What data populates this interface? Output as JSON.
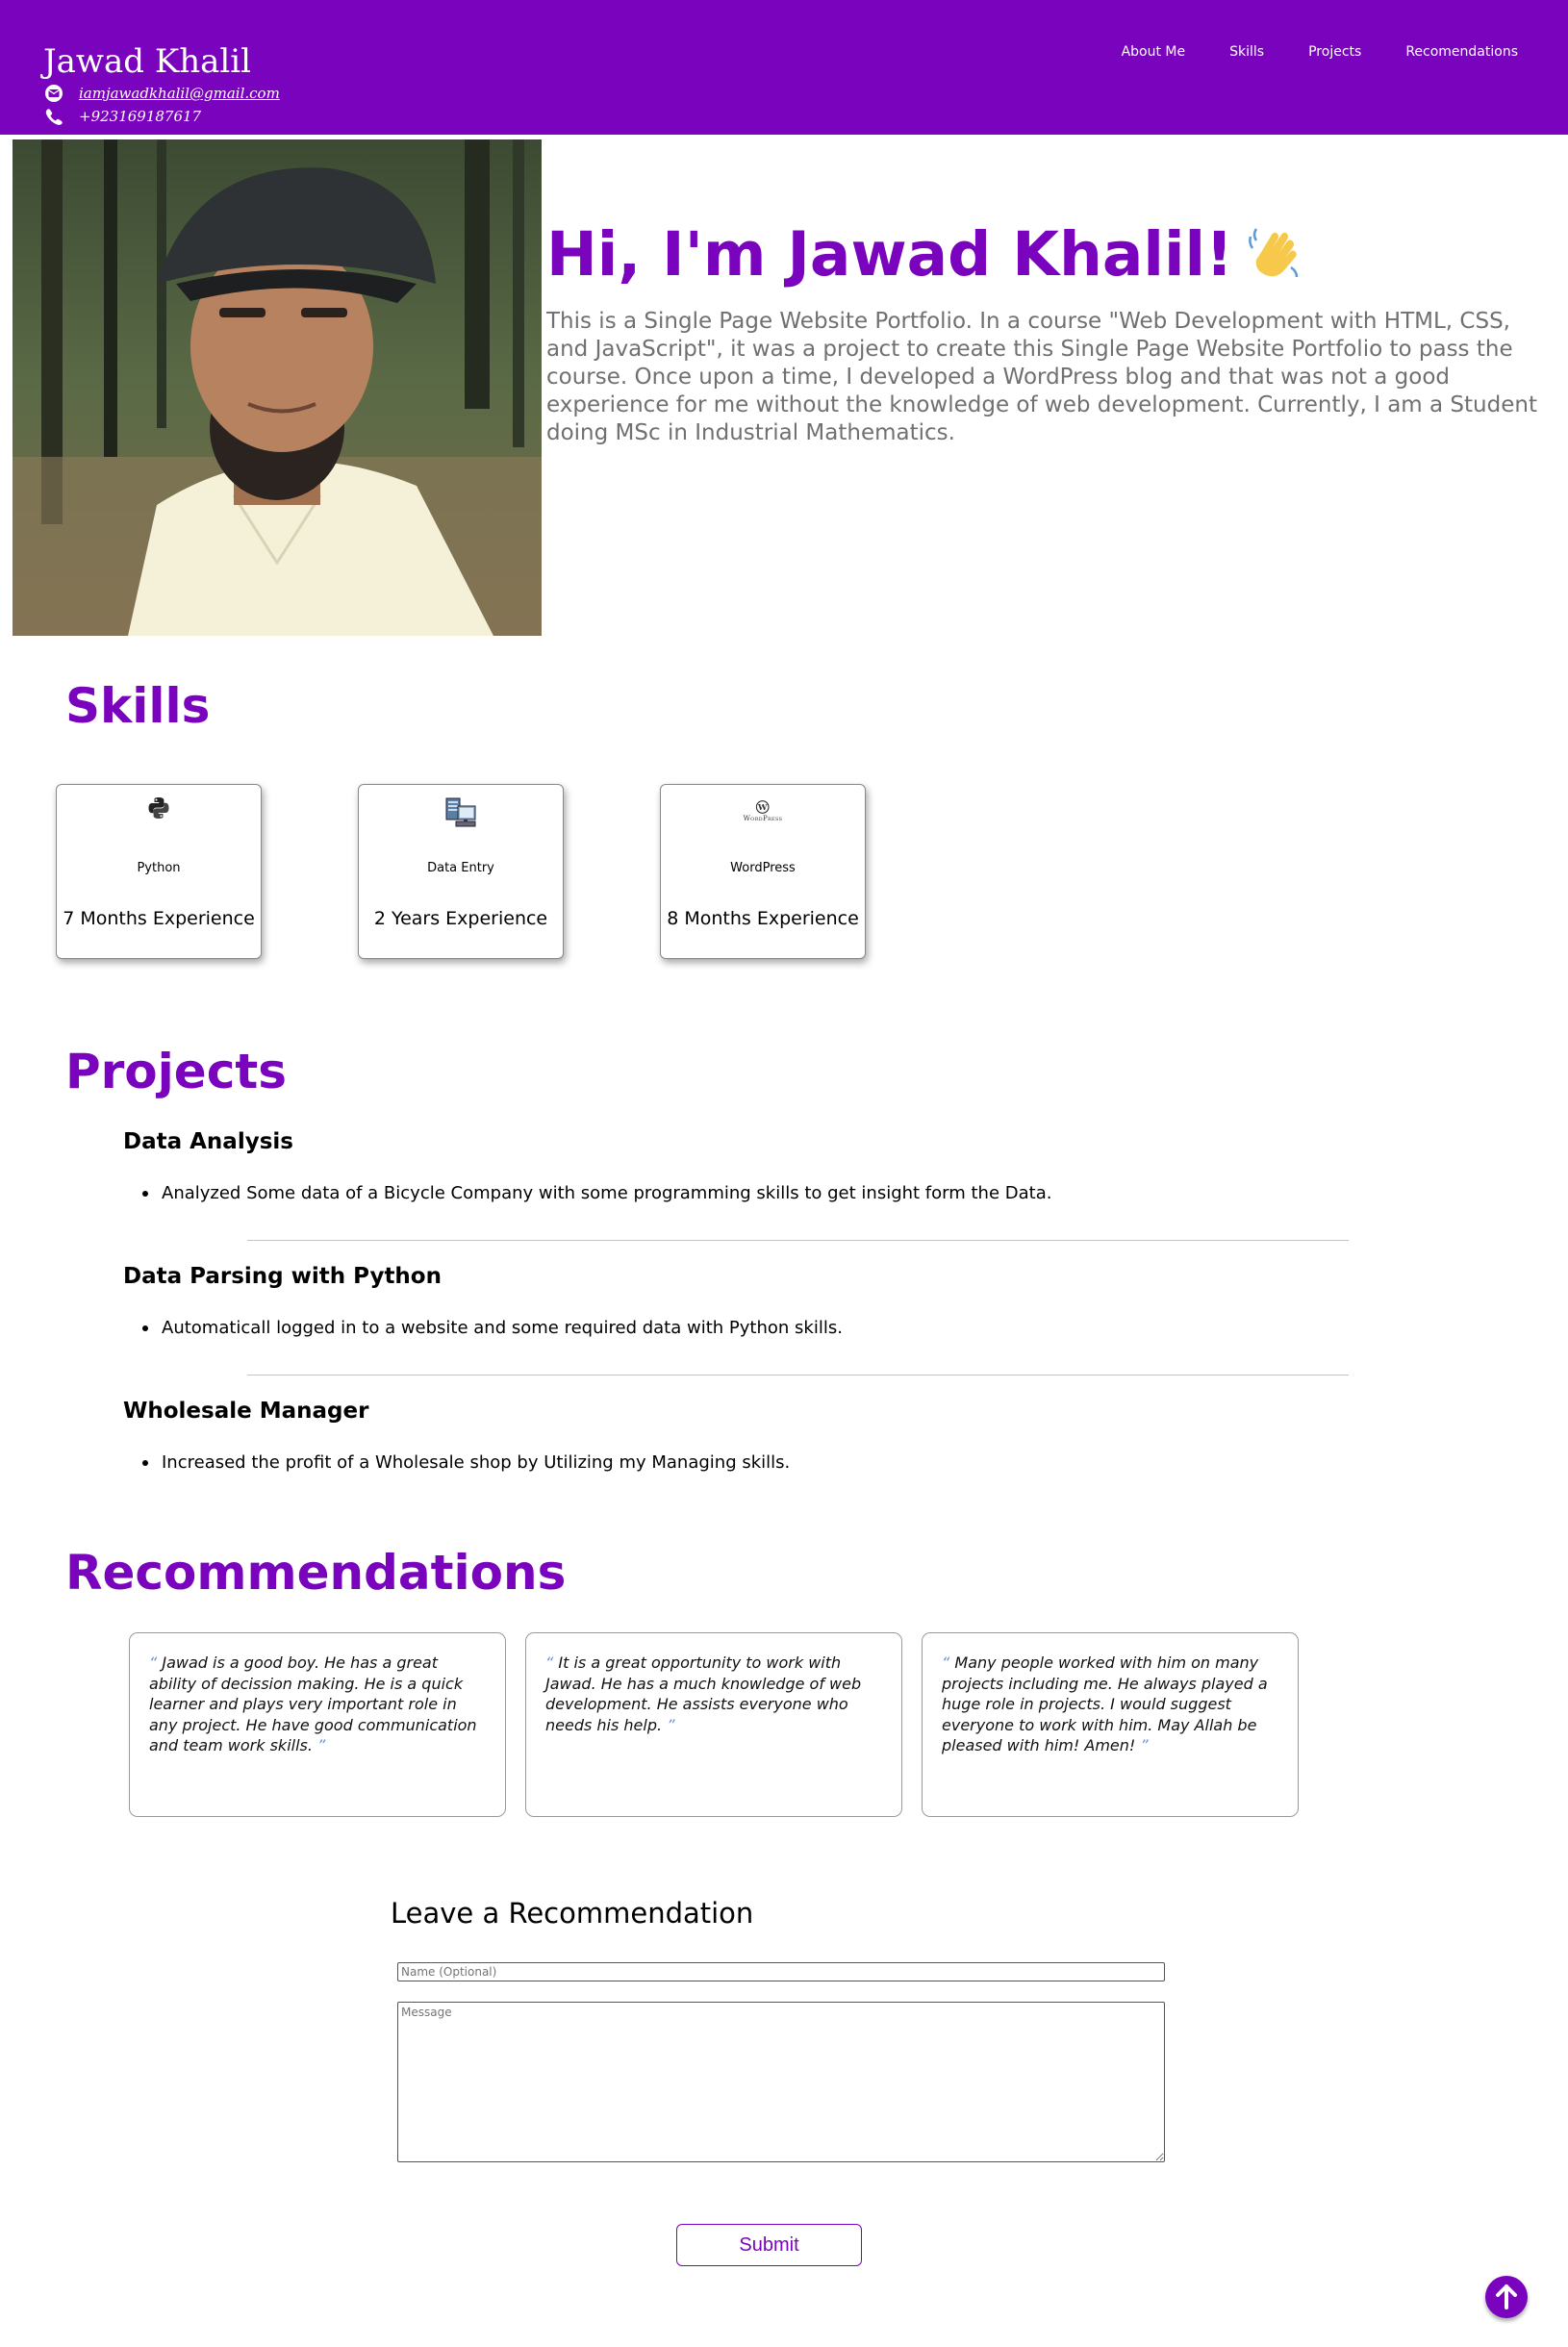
{
  "colors": {
    "accent": "#7a03bd",
    "white": "#ffffff",
    "gray_text": "#707070"
  },
  "header": {
    "name": "Jawad Khalil",
    "email": "iamjawadkhalil@gmail.com",
    "phone": "+923169187617",
    "email_icon": "envelope-icon",
    "phone_icon": "phone-icon",
    "nav": [
      "About Me",
      "Skills",
      "Projects",
      "Recomendations"
    ]
  },
  "profile": {
    "photo_alt": "profile-photo",
    "greeting": "Hi, I'm Jawad Khalil!",
    "wave_icon": "waving-hand-icon",
    "bio": "This is a Single Page Website Portfolio. In a course \"Web Development with HTML, CSS, and JavaScript\", it was a project to create this Single Page Website Portfolio to pass the course. Once upon a time, I developed a WordPress blog and that was not a good experience for me without the knowledge of web development. Currently, I am a Student doing MSc in Industrial Mathematics."
  },
  "skills": {
    "title": "Skills",
    "items": [
      {
        "icon": "python-icon",
        "name": "Python",
        "experience": "7 Months Experience"
      },
      {
        "icon": "data-entry-icon",
        "name": "Data Entry",
        "experience": "2 Years Experience"
      },
      {
        "icon": "wordpress-icon",
        "name": "WordPress",
        "experience": "8 Months Experience",
        "icon_caption": "WordPress"
      }
    ]
  },
  "projects": {
    "title": "Projects",
    "items": [
      {
        "title": "Data Analysis",
        "detail": "Analyzed Some data of a Bicycle Company with some programming skills to get insight form the Data."
      },
      {
        "title": "Data Parsing with Python",
        "detail": "Automaticall logged in to a website and some required data with Python skills."
      },
      {
        "title": "Wholesale Manager",
        "detail": "Increased the profit of a Wholesale shop by Utilizing my Managing skills."
      }
    ]
  },
  "recommendations": {
    "title": "Recommendations",
    "open_quote": "“",
    "close_quote": "”",
    "items": [
      {
        "text": "Jawad is a good boy. He has a great ability of decission making. He is a quick learner and plays very important role in any project. He have good communication and team work skills."
      },
      {
        "text": "It is a great opportunity to work with Jawad. He has a much knowledge of web development. He assists everyone who needs his help."
      },
      {
        "text": "Many people worked with him on many projects including me. He always played a huge role in projects. I would suggest everyone to work with him. May Allah be pleased with him! Amen!"
      }
    ]
  },
  "form": {
    "title": "Leave a Recommendation",
    "name_placeholder": "Name (Optional)",
    "message_placeholder": "Message",
    "submit_label": "Submit"
  },
  "scroll_top": {
    "icon": "arrow-up-icon"
  }
}
